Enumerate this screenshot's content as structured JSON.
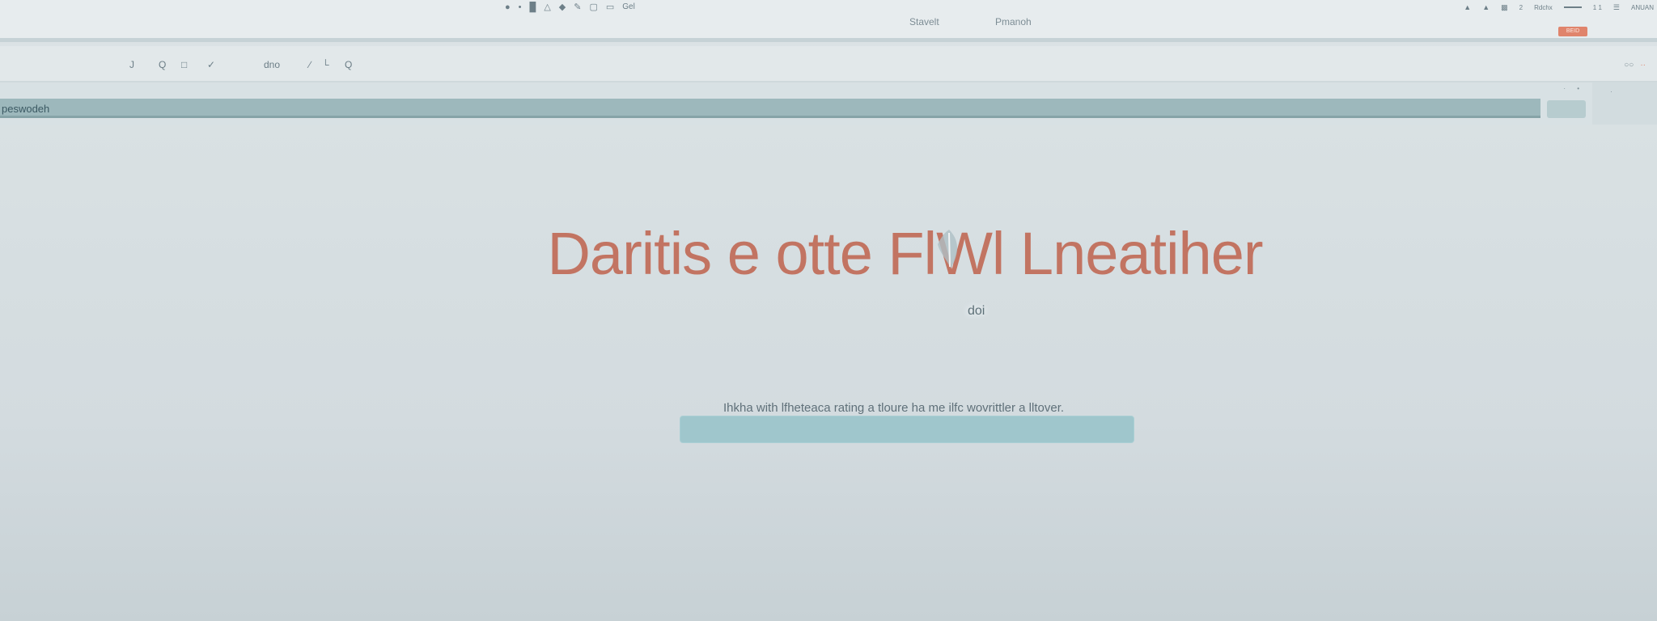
{
  "topbar": {
    "corner_mark": "",
    "center_icon_label": "Gel",
    "tabs": [
      "Stavelt",
      "Pmanoh"
    ],
    "right_icons": [
      "up-arrow-icon",
      "bell-icon",
      "battery-icon",
      "close-icon",
      "menu-icon"
    ],
    "right_texts": [
      "2",
      "Rdchx",
      "1 1",
      "ANUAN"
    ],
    "badge_label": "BEID"
  },
  "toolbar": {
    "items": [
      "J",
      "Q",
      "□",
      "✓"
    ],
    "text_item": "dno",
    "draw_items": [
      "∕",
      "└",
      "Q"
    ],
    "right_tools": [
      "○○",
      "··"
    ]
  },
  "address": {
    "url_text": "peswodeh",
    "tiny_marks": "·  •",
    "side_mark": "·"
  },
  "main": {
    "title": "Daritis e otte  FlWl Lneatiher",
    "sub_label": "doi",
    "description": "Ihkha with lfheteaca rating a tloure ha me ilfc wovrittler a lltover.",
    "field_value": ""
  },
  "colors": {
    "accent": "#c27462",
    "badge": "#e0846c",
    "field": "#9fc6cc",
    "url_bar": "#9db8bc"
  }
}
